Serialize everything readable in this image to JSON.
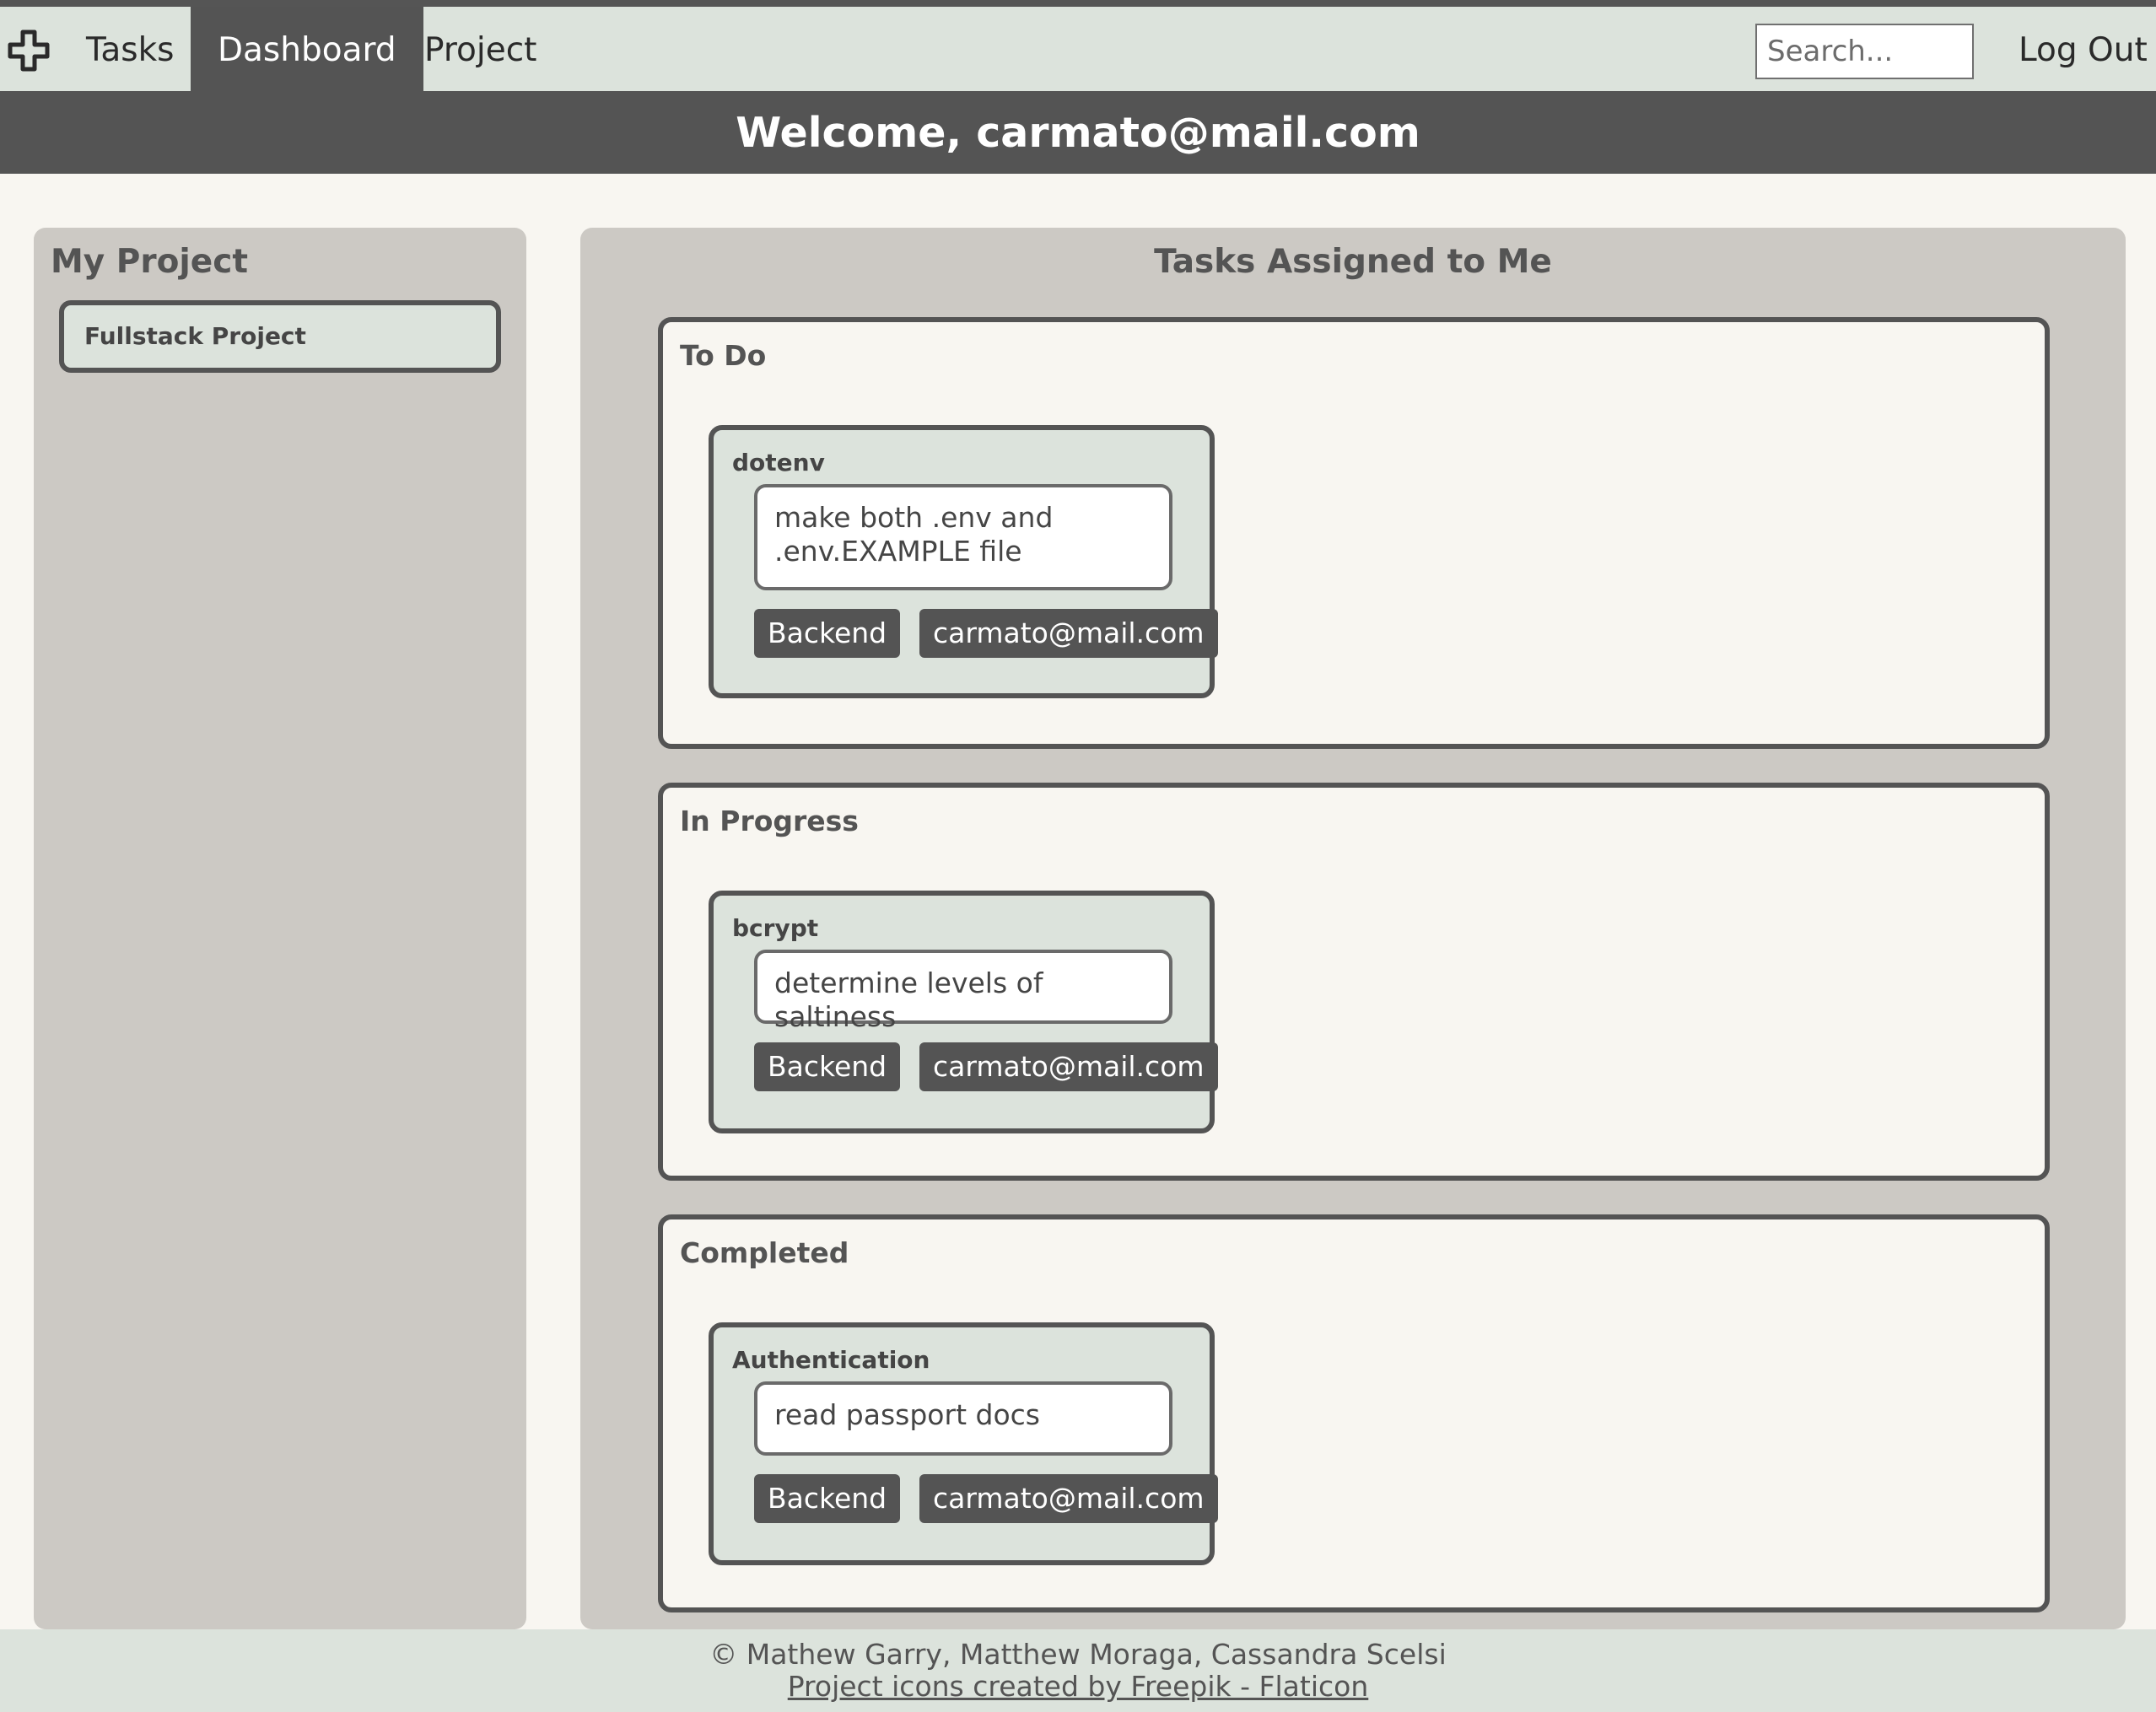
{
  "nav": {
    "tabs": [
      {
        "label": "Tasks"
      },
      {
        "label": "Dashboard"
      },
      {
        "label": "Project"
      }
    ],
    "search_placeholder": "Search...",
    "logout_label": "Log Out"
  },
  "welcome": "Welcome, carmato@mail.com",
  "sidebar": {
    "title": "My Project",
    "projects": [
      {
        "name": "Fullstack Project"
      }
    ]
  },
  "main": {
    "title": "Tasks Assigned to Me",
    "columns": [
      {
        "title": "To Do",
        "cards": [
          {
            "name": "dotenv",
            "description": "make both .env and .env.EXAMPLE file",
            "tag": "Backend",
            "assignee": "carmato@mail.com"
          }
        ]
      },
      {
        "title": "In Progress",
        "cards": [
          {
            "name": "bcrypt",
            "description": "determine levels of saltiness",
            "tag": "Backend",
            "assignee": "carmato@mail.com"
          }
        ]
      },
      {
        "title": "Completed",
        "cards": [
          {
            "name": "Authentication",
            "description": "read passport docs",
            "tag": "Backend",
            "assignee": "carmato@mail.com"
          }
        ]
      }
    ]
  },
  "footer": {
    "copyright": "© Mathew Garry, Matthew Moraga, Cassandra Scelsi",
    "credit": "Project icons created by Freepik - Flaticon"
  },
  "colors": {
    "nav_bg": "#dce3dc",
    "dark": "#545454",
    "panel": "#ccc9c4",
    "page_bg": "#f8f6f1"
  },
  "icons": {
    "logo": "cross-icon"
  }
}
